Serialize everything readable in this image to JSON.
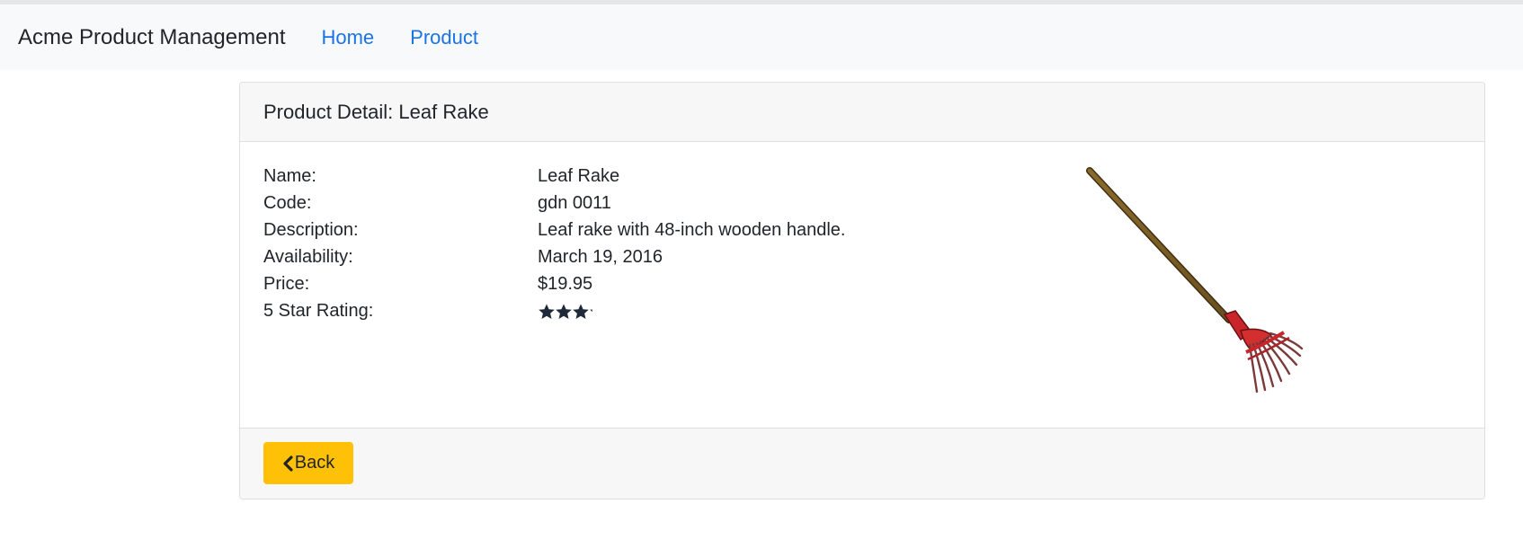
{
  "navbar": {
    "brand": "Acme Product Management",
    "links": [
      {
        "label": "Home"
      },
      {
        "label": "Product"
      }
    ],
    "link_color": "#1a73e8",
    "background": "#f8f9fa"
  },
  "product_detail": {
    "header": "Product Detail: Leaf Rake",
    "rows": [
      {
        "label": "Name:",
        "value": "Leaf Rake"
      },
      {
        "label": "Code:",
        "value": "gdn 0011"
      },
      {
        "label": "Description:",
        "value": "Leaf rake with 48-inch wooden handle."
      },
      {
        "label": "Availability:",
        "value": "March 19, 2016"
      },
      {
        "label": "Price:",
        "value": "$19.95"
      }
    ],
    "rating_label": "5 Star Rating:",
    "rating": 3.2,
    "rating_max": 5,
    "image_alt": "Leaf Rake",
    "image_icon": "leaf-rake-image"
  },
  "footer": {
    "back_label": "Back",
    "back_icon": "chevron-left-icon",
    "button_color": "#ffc107"
  }
}
